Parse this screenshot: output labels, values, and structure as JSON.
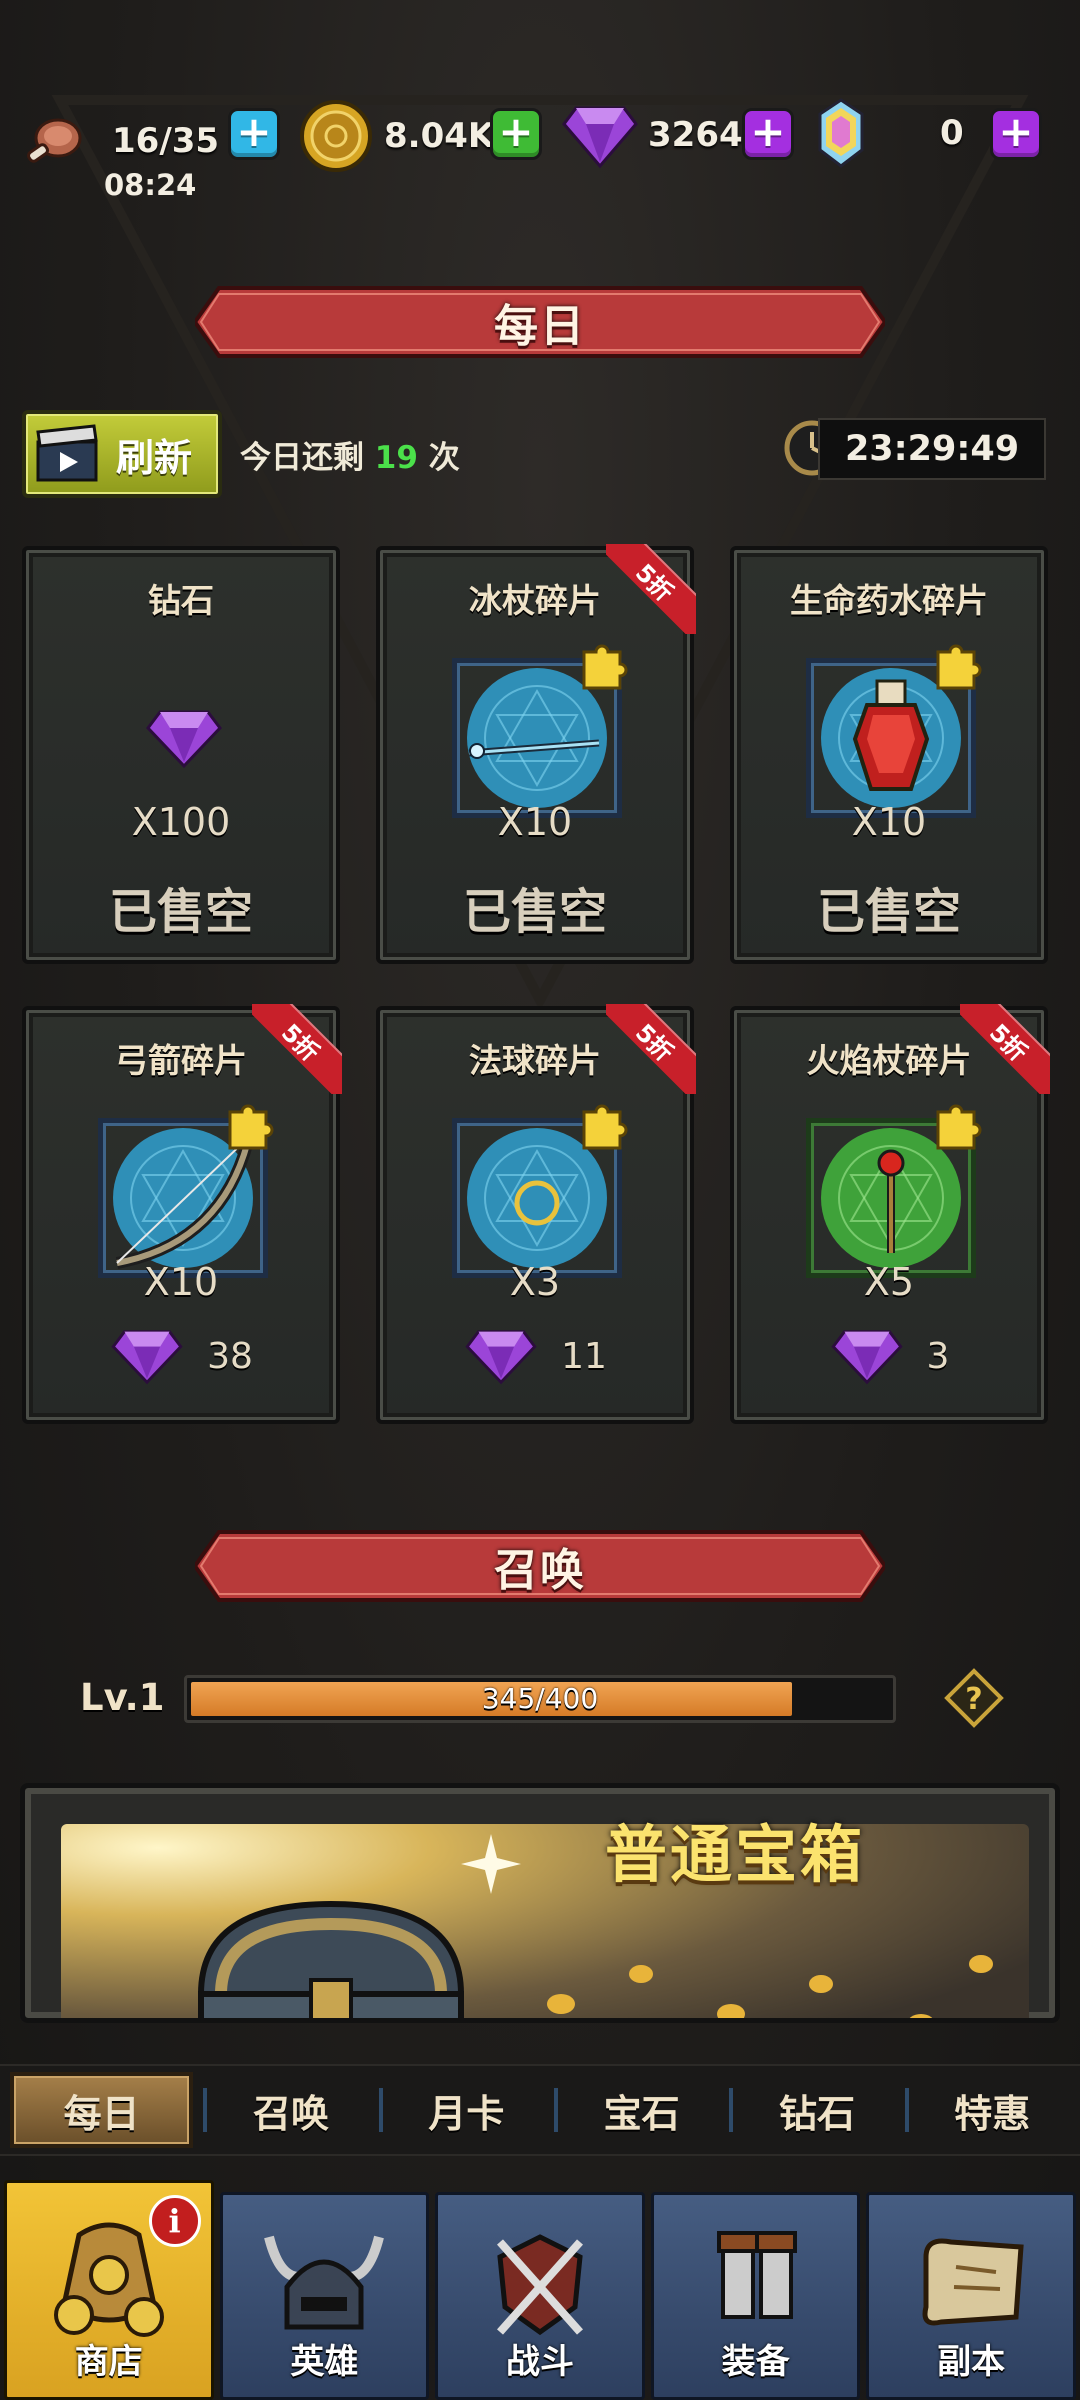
{
  "resources": {
    "stamina": "16/35",
    "stamina_timer": "08:24",
    "gold": "8.04K",
    "diamonds": "3264",
    "crystals": "0"
  },
  "daily": {
    "banner": "每日",
    "refresh_label": "刷新",
    "remain_prefix": "今日还剩",
    "remain_count": "19",
    "remain_suffix": "次",
    "timer": "23:29:49",
    "items": [
      {
        "title": "钻石",
        "qty": "X100",
        "status": "已售空",
        "discount": "",
        "icon": "diamond-icon"
      },
      {
        "title": "冰杖碎片",
        "qty": "X10",
        "status": "已售空",
        "discount": "5折",
        "icon": "ice-staff-icon"
      },
      {
        "title": "生命药水碎片",
        "qty": "X10",
        "status": "已售空",
        "discount": "",
        "icon": "life-potion-icon"
      },
      {
        "title": "弓箭碎片",
        "qty": "X10",
        "price": "38",
        "discount": "5折",
        "icon": "bow-icon"
      },
      {
        "title": "法球碎片",
        "qty": "X3",
        "price": "11",
        "discount": "5折",
        "icon": "orb-icon"
      },
      {
        "title": "火焰杖碎片",
        "qty": "X5",
        "price": "3",
        "discount": "5折",
        "icon": "fire-staff-icon"
      }
    ]
  },
  "summon": {
    "banner": "召唤",
    "level": "Lv.1",
    "progress_text": "345/400",
    "progress_fraction": 0.8625,
    "chest_title": "普通宝箱"
  },
  "subtabs": [
    "每日",
    "召唤",
    "月卡",
    "宝石",
    "钻石",
    "特惠"
  ],
  "nav": [
    {
      "label": "商店",
      "icon": "shop-bag-icon",
      "badge": "i"
    },
    {
      "label": "英雄",
      "icon": "helmet-icon"
    },
    {
      "label": "战斗",
      "icon": "crossed-swords-icon"
    },
    {
      "label": "装备",
      "icon": "boots-icon"
    },
    {
      "label": "副本",
      "icon": "scroll-map-icon"
    }
  ],
  "colors": {
    "accent_gold": "#f2c437",
    "ribbon_red": "#b83a3a",
    "progress_orange": "#e08a30",
    "diamond_purple": "#9b45d8"
  }
}
